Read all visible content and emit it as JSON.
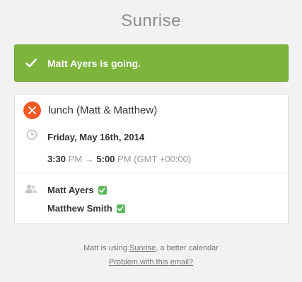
{
  "brand": "Sunrise",
  "banner": {
    "message": "Matt Ayers is going."
  },
  "event": {
    "title": "lunch (Matt & Matthew)",
    "date": "Friday, May 16th, 2014",
    "start_time": "3:30",
    "start_period": " PM",
    "arrow": " → ",
    "end_time": "5:00",
    "end_period": " PM",
    "timezone": " (GMT +00:00)"
  },
  "attendees": [
    {
      "name": "Matt Ayers"
    },
    {
      "name": "Matthew Smith"
    }
  ],
  "footer": {
    "line1_prefix": "Matt is using ",
    "sunrise_link": "Sunrise",
    "line1_suffix": ", a better calendar",
    "problem_link": "Problem with this email?"
  },
  "colors": {
    "banner": "#7db43c",
    "event_badge": "#f25a24",
    "accepted": "#5cb85c"
  },
  "icons": [
    "check-icon",
    "fork-knife-icon",
    "clock-icon",
    "people-icon"
  ]
}
